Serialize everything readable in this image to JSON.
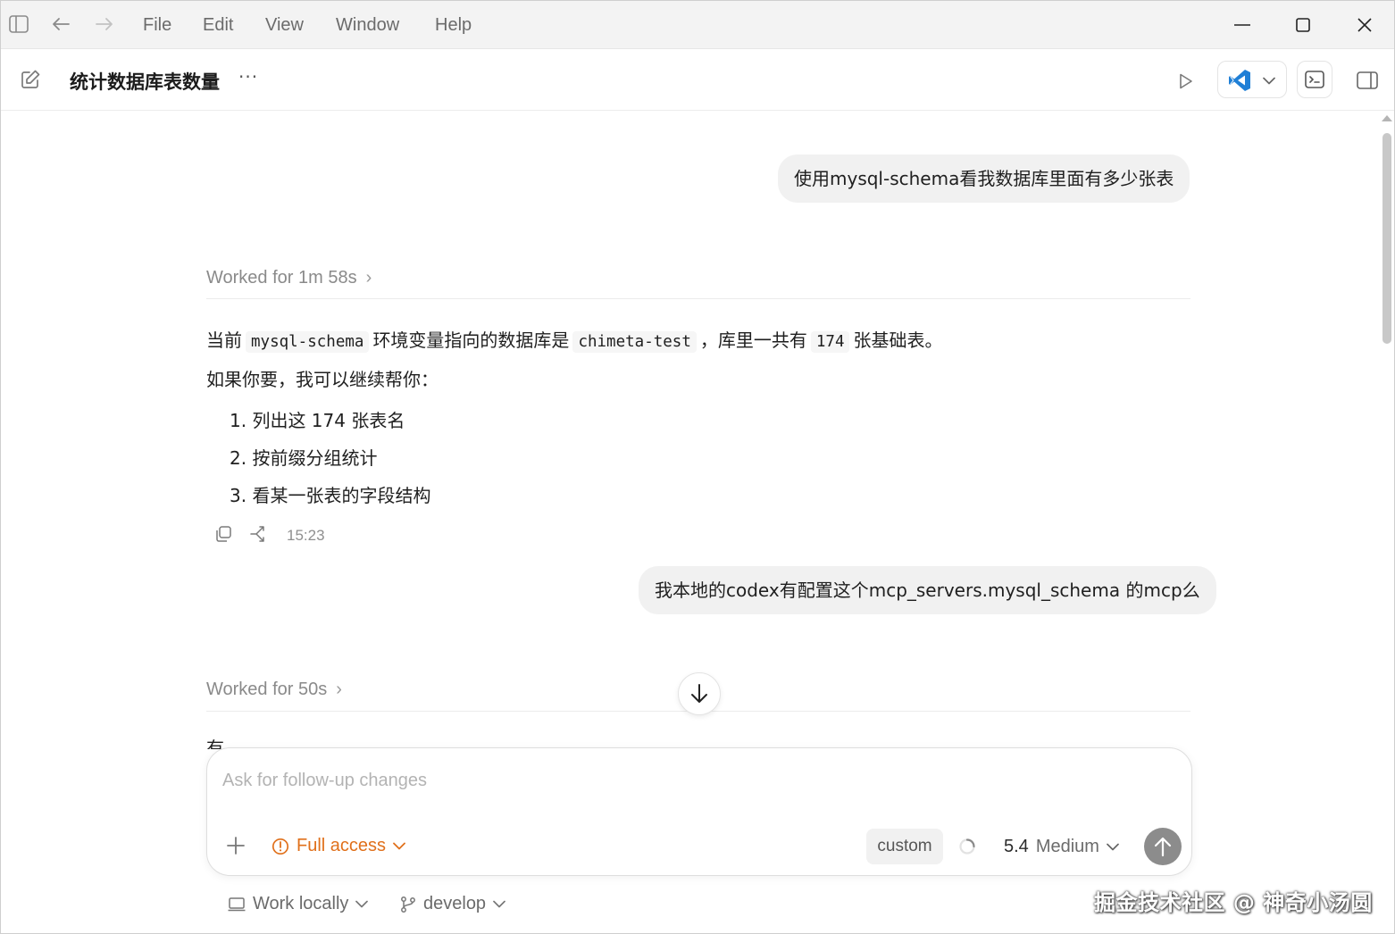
{
  "menubar": {
    "items": [
      "File",
      "Edit",
      "View",
      "Window",
      "Help"
    ]
  },
  "header": {
    "title": "统计数据库表数量",
    "more": "···"
  },
  "conversation": {
    "user_msg_1": "使用mysql-schema看我数据库里面有多少张表",
    "worked_1": "Worked for 1m 58s",
    "answer": {
      "p1_a": "当前",
      "p1_code1": "mysql-schema",
      "p1_b": "环境变量指向的数据库是",
      "p1_code2": "chimeta-test",
      "p1_c": "，库里一共有",
      "p1_code3": "174",
      "p1_d": "张基础表。",
      "p2": "如果你要，我可以继续帮你：",
      "list": [
        "1. 列出这 174 张表名",
        "2. 按前缀分组统计",
        "3. 看某一张表的字段结构"
      ]
    },
    "timestamp": "15:23",
    "user_msg_2": "我本地的codex有配置这个mcp_servers.mysql_schema 的mcp么",
    "worked_2": "Worked for 50s",
    "partial_text": "有"
  },
  "composer": {
    "placeholder": "Ask for follow-up changes",
    "access_label": "Full access",
    "custom_chip": "custom",
    "model_version": "5.4",
    "model_effort": "Medium"
  },
  "footer": {
    "work_locally": "Work locally",
    "branch": "develop"
  },
  "watermark": "掘金技术社区 @ 神奇小汤圆",
  "colors": {
    "accent_orange": "#e0701b",
    "vscode_blue": "#1f7fd6",
    "bubble_bg": "#f1f1f1"
  }
}
